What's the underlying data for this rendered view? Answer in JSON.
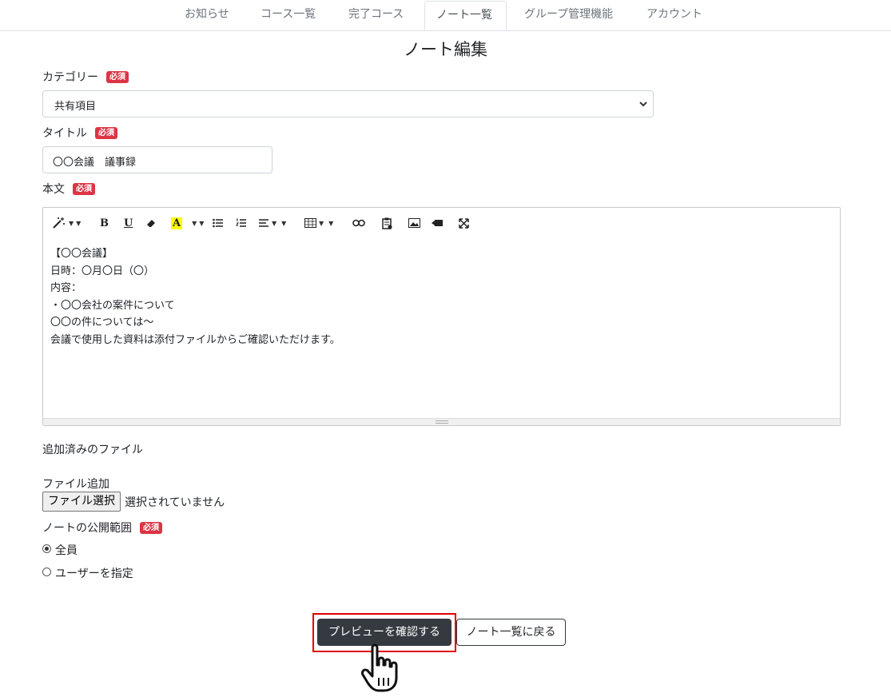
{
  "nav": {
    "tabs": [
      {
        "label": "お知らせ"
      },
      {
        "label": "コース一覧"
      },
      {
        "label": "完了コース"
      },
      {
        "label": "ノート一覧",
        "active": true
      },
      {
        "label": "グループ管理機能"
      },
      {
        "label": "アカウント"
      }
    ]
  },
  "page": {
    "title": "ノート編集"
  },
  "required_badge": "必須",
  "form": {
    "category": {
      "label": "カテゴリー",
      "value": "共有項目"
    },
    "title": {
      "label": "タイトル",
      "value": "〇〇会議　議事録"
    },
    "body": {
      "label": "本文",
      "toolbar_icons": [
        "magic-icon",
        "bold-icon",
        "underline-icon",
        "eraser-icon",
        "font-color-icon",
        "unordered-list-icon",
        "ordered-list-icon",
        "paragraph-align-icon",
        "table-icon",
        "link-icon",
        "clipboard-icon",
        "picture-icon",
        "video-icon",
        "fullscreen-icon"
      ],
      "lines": [
        "【〇〇会議】",
        "日時：〇月〇日（〇）",
        "内容：",
        "・〇〇会社の案件について",
        "〇〇の件については～",
        "会議で使用した資料は添付ファイルからご確認いただけます。"
      ]
    },
    "attached_files_label": "追加済みのファイル",
    "file_add": {
      "label": "ファイル追加",
      "button": "ファイル選択",
      "status": "選択されていません"
    },
    "visibility": {
      "label": "ノートの公開範囲",
      "options": [
        {
          "label": "全員",
          "checked": true
        },
        {
          "label": "ユーザーを指定",
          "checked": false
        }
      ]
    }
  },
  "actions": {
    "preview": "プレビューを確認する",
    "back": "ノート一覧に戻る"
  },
  "colors": {
    "accent_dark": "#343a40",
    "required_badge": "#dc3545",
    "highlight": "#e00000",
    "font_color_highlight": "#ffff00"
  }
}
